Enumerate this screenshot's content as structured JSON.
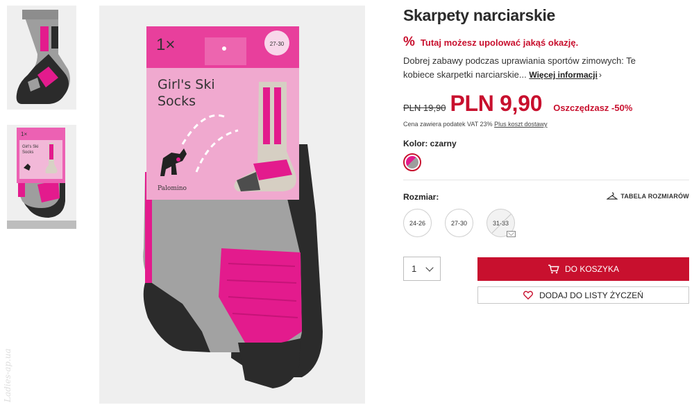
{
  "product": {
    "title": "Skarpety narciarskie",
    "deal_icon": "%",
    "deal_text": "Tutaj możesz upolować jakąś okazję.",
    "description": "Dobrej zabawy podczas uprawiania sportów zimowych: Te kobiece skarpetki narciarskie...",
    "more_link": "Więcej informacji",
    "old_price": "PLN 19,90",
    "new_price": "PLN 9,90",
    "saving": "Oszczędzasz -50%",
    "vat_text": "Cena zawiera podatek VAT 23%",
    "shipping_link": "Plus koszt dostawy",
    "color_label": "Kolor: czarny",
    "size_label": "Rozmiar:",
    "size_table_label": "TABELA ROZMIARÓW",
    "sizes": [
      {
        "label": "24-26",
        "available": true
      },
      {
        "label": "27-30",
        "available": true
      },
      {
        "label": "31-33",
        "available": false
      }
    ],
    "quantity": "1",
    "add_to_cart": "DO KOSZYKA",
    "add_to_wishlist": "DODAJ DO LISTY ŻYCZEŃ"
  },
  "packaging": {
    "count": "1×",
    "size": "27-30",
    "product_name_line1": "Girl's Ski",
    "product_name_line2": "Socks",
    "brand": "Palomino"
  },
  "watermark": "Ladies-ap.ua",
  "colors": {
    "accent": "#c8102e",
    "sock_pink": "#e31b8d",
    "sock_grey": "#9d9d9d",
    "sock_black": "#2b2b2b"
  },
  "icons": {
    "deal": "percent-icon",
    "more": "chevron-right-icon",
    "size_table": "hanger-icon",
    "unavailable": "mail-icon",
    "quantity": "chevron-down-icon",
    "cart": "cart-icon",
    "wishlist": "heart-icon"
  }
}
